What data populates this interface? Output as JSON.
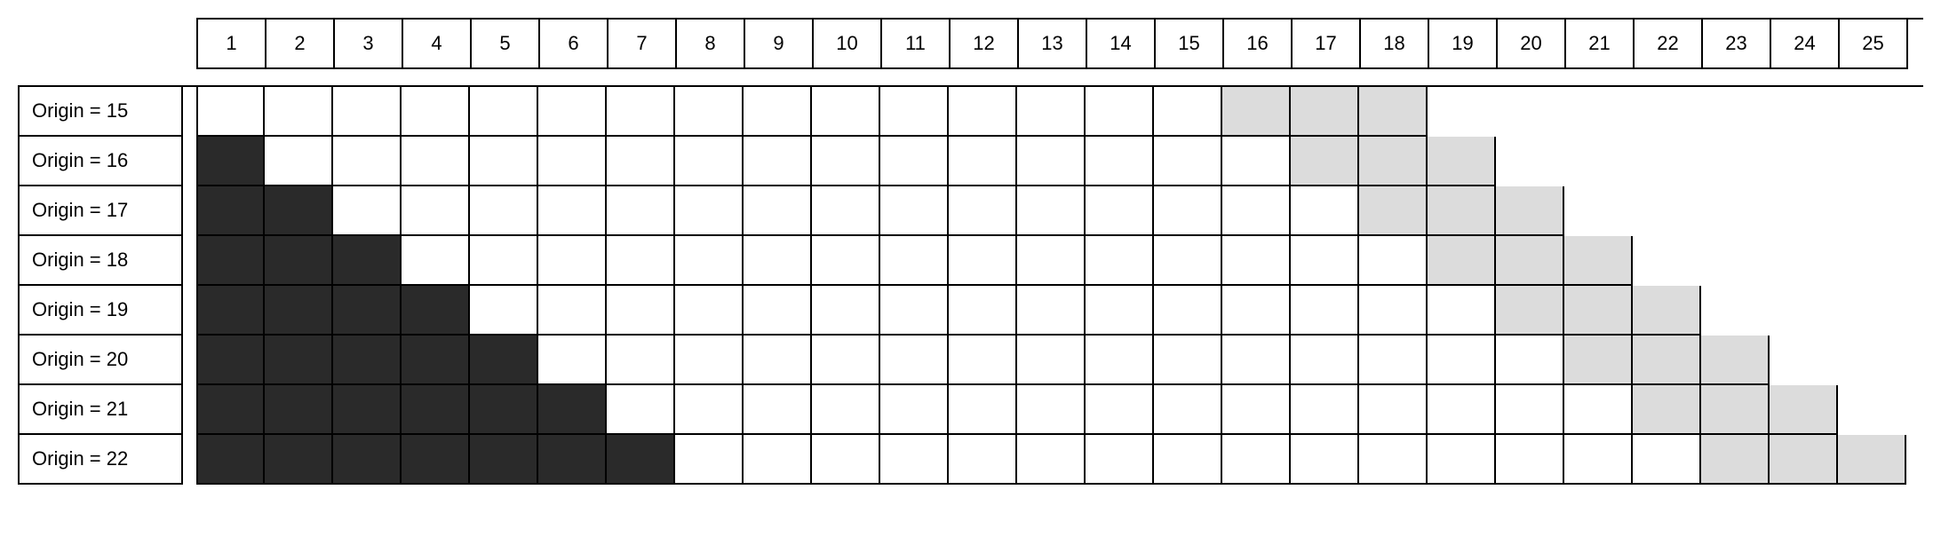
{
  "columns": 25,
  "origins": [
    15,
    16,
    17,
    18,
    19,
    20,
    21,
    22
  ],
  "label_template": "Origin = {n}",
  "window_size": 15,
  "trail_size": 3,
  "colors": {
    "past": "#2a2a2a",
    "window": "#ffffff",
    "trail": "#dcdcdc"
  }
}
